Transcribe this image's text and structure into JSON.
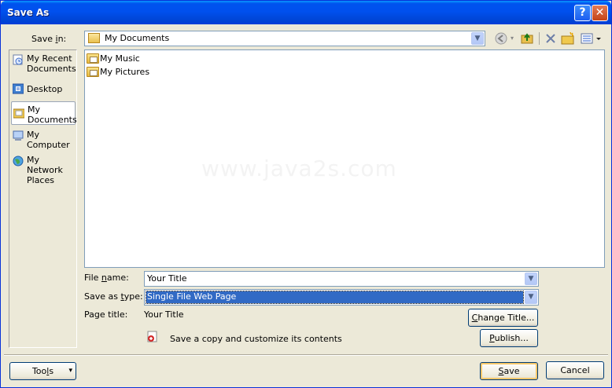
{
  "window": {
    "title": "Save As",
    "help_symbol": "?",
    "close_symbol": "✕"
  },
  "save_in": {
    "label_pre": "Save ",
    "label_accel": "i",
    "label_post": "n:",
    "value": "My Documents"
  },
  "places": [
    {
      "line1": "My Recent",
      "line2": "Documents",
      "icon": "recent-documents-icon"
    },
    {
      "line1": "Desktop",
      "line2": "",
      "icon": "desktop-icon"
    },
    {
      "line1": "My",
      "line2": "Documents",
      "icon": "my-documents-icon",
      "selected": true
    },
    {
      "line1": "My",
      "line2": "Computer",
      "icon": "my-computer-icon"
    },
    {
      "line1": "My Network",
      "line2": "Places",
      "icon": "network-places-icon"
    }
  ],
  "files": [
    {
      "name": "My Music"
    },
    {
      "name": "My Pictures"
    }
  ],
  "watermark": "www.java2s.com",
  "file_name": {
    "label_pre": "File ",
    "label_accel": "n",
    "label_post": "ame:",
    "value": "Your Title"
  },
  "save_as_type": {
    "label_pre": "Save as ",
    "label_accel": "t",
    "label_post": "ype:",
    "value": "Single File Web Page"
  },
  "page_title": {
    "label": "Page title:",
    "value": "Your Title"
  },
  "change_title_button": {
    "pre": "",
    "accel": "C",
    "post": "hange Title..."
  },
  "save_copy_text": "Save a copy and customize its contents",
  "publish_button": {
    "pre": "",
    "accel": "P",
    "post": "ublish..."
  },
  "tools_button": {
    "pre": "Too",
    "accel": "l",
    "post": "s",
    "arrow": "▾"
  },
  "save_button": {
    "pre": "",
    "accel": "S",
    "post": "ave"
  },
  "cancel_button": {
    "label": "Cancel"
  },
  "colors": {
    "titlebar": "#0054e3",
    "dialog_bg": "#ece9d8",
    "selection": "#316ac5"
  }
}
